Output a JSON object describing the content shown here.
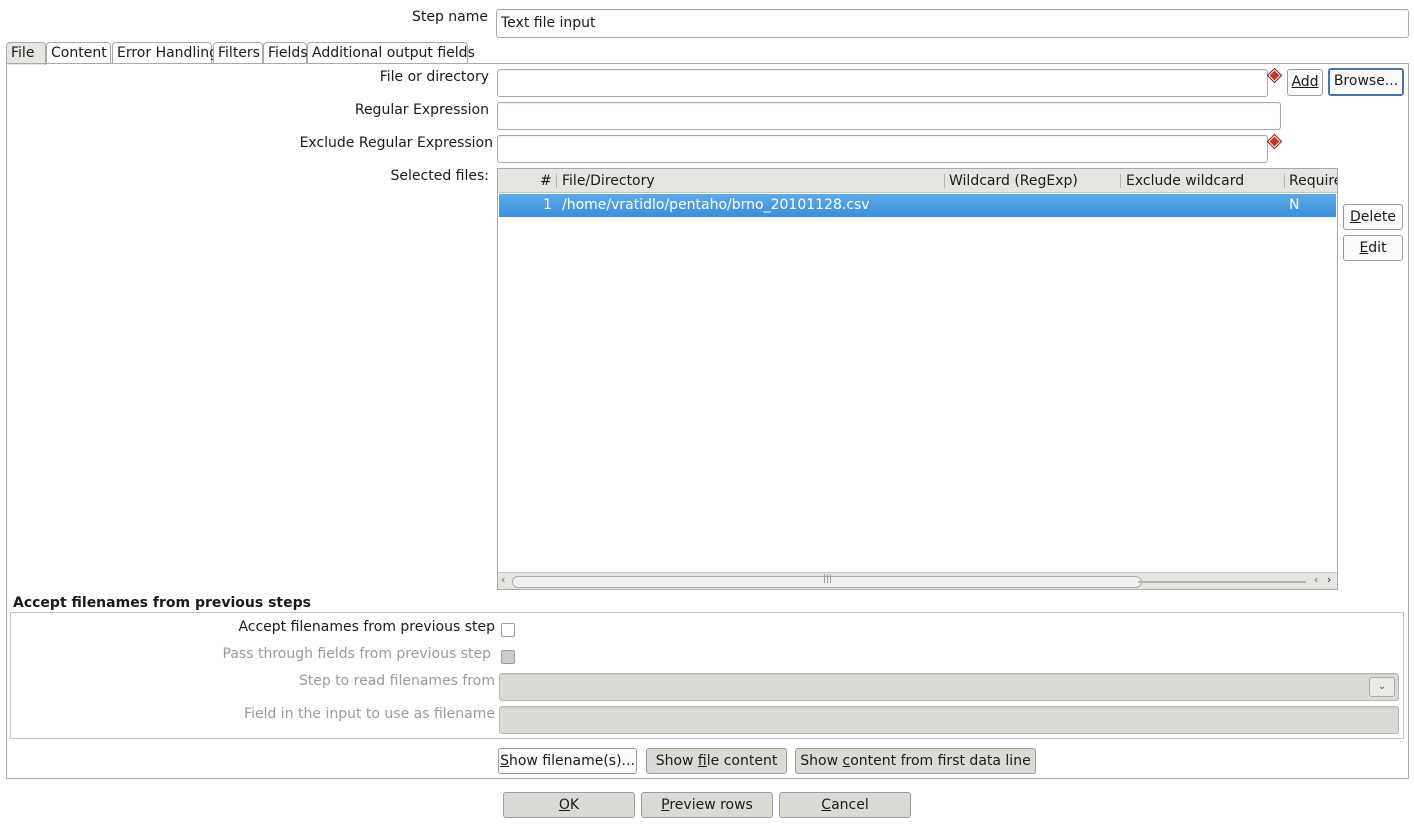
{
  "step": {
    "label": "Step name",
    "value": "Text file input"
  },
  "tabs": [
    {
      "label": "File"
    },
    {
      "label": "Content"
    },
    {
      "label": "Error Handling"
    },
    {
      "label": "Filters"
    },
    {
      "label": "Fields"
    },
    {
      "label": "Additional output fields"
    }
  ],
  "file_tab": {
    "file_or_directory_label": "File or directory",
    "file_or_directory_value": "",
    "add_button": "Add",
    "browse_button": "Browse...",
    "regex_label": "Regular Expression",
    "regex_value": "",
    "exclude_regex_label": "Exclude Regular Expression",
    "exclude_regex_value": "",
    "selected_files_label": "Selected files:",
    "table": {
      "columns": [
        "#",
        "File/Directory",
        "Wildcard (RegExp)",
        "Exclude wildcard",
        "Require"
      ],
      "rows": [
        {
          "num": "1",
          "path": "/home/vratidlo/pentaho/brno_20101128.csv",
          "wildcard": "",
          "exclude": "",
          "required": "N"
        }
      ]
    },
    "delete_button": "Delete",
    "edit_button": "Edit"
  },
  "accept": {
    "section_title": "Accept filenames from previous steps",
    "accept_label": "Accept filenames from previous step",
    "pass_through_label": "Pass through fields from previous step",
    "step_to_read_label": "Step to read filenames from",
    "step_to_read_value": "",
    "field_label": "Field in the input to use as filename",
    "field_value": ""
  },
  "actions": {
    "show_filenames": "Show filename(s)...",
    "show_file_content": "Show file content",
    "show_content_first_line": "Show content from first data line"
  },
  "footer": {
    "ok": "OK",
    "preview": "Preview rows",
    "cancel": "Cancel"
  },
  "colors": {
    "selection": "#3c8edb",
    "panel_bg": "#dcdad5",
    "accent_border": "#4a74a8",
    "required_marker": "#c0392b"
  }
}
